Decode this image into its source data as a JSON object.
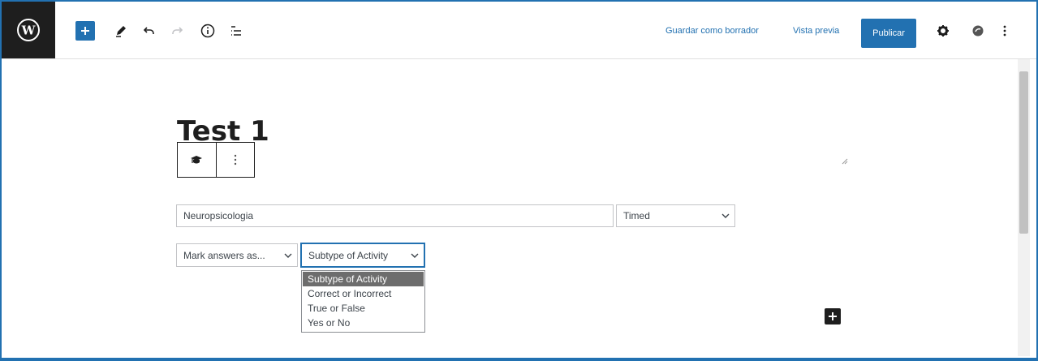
{
  "toolbar": {
    "save_draft_label": "Guardar como borrador",
    "preview_label": "Vista previa",
    "publish_label": "Publicar",
    "icons": [
      "wordpress-logo",
      "plus-icon",
      "pencil-icon",
      "undo-icon",
      "redo-icon",
      "info-icon",
      "list-view-icon",
      "gear-icon",
      "plugin-icon",
      "kebab-menu-icon"
    ]
  },
  "post": {
    "title": "Test 1"
  },
  "fields": {
    "subject_value": "Neuropsicologia",
    "timing_value": "Timed",
    "mark_answers_value": "Mark answers as...",
    "subtype_value": "Subtype of Activity"
  },
  "dropdown": {
    "options": [
      "Subtype of Activity",
      "Correct or Incorrect",
      "True or False",
      "Yes or No"
    ],
    "selected": "Subtype of Activity"
  },
  "colors": {
    "accent": "#2271b1",
    "dark": "#1e1e1e"
  }
}
